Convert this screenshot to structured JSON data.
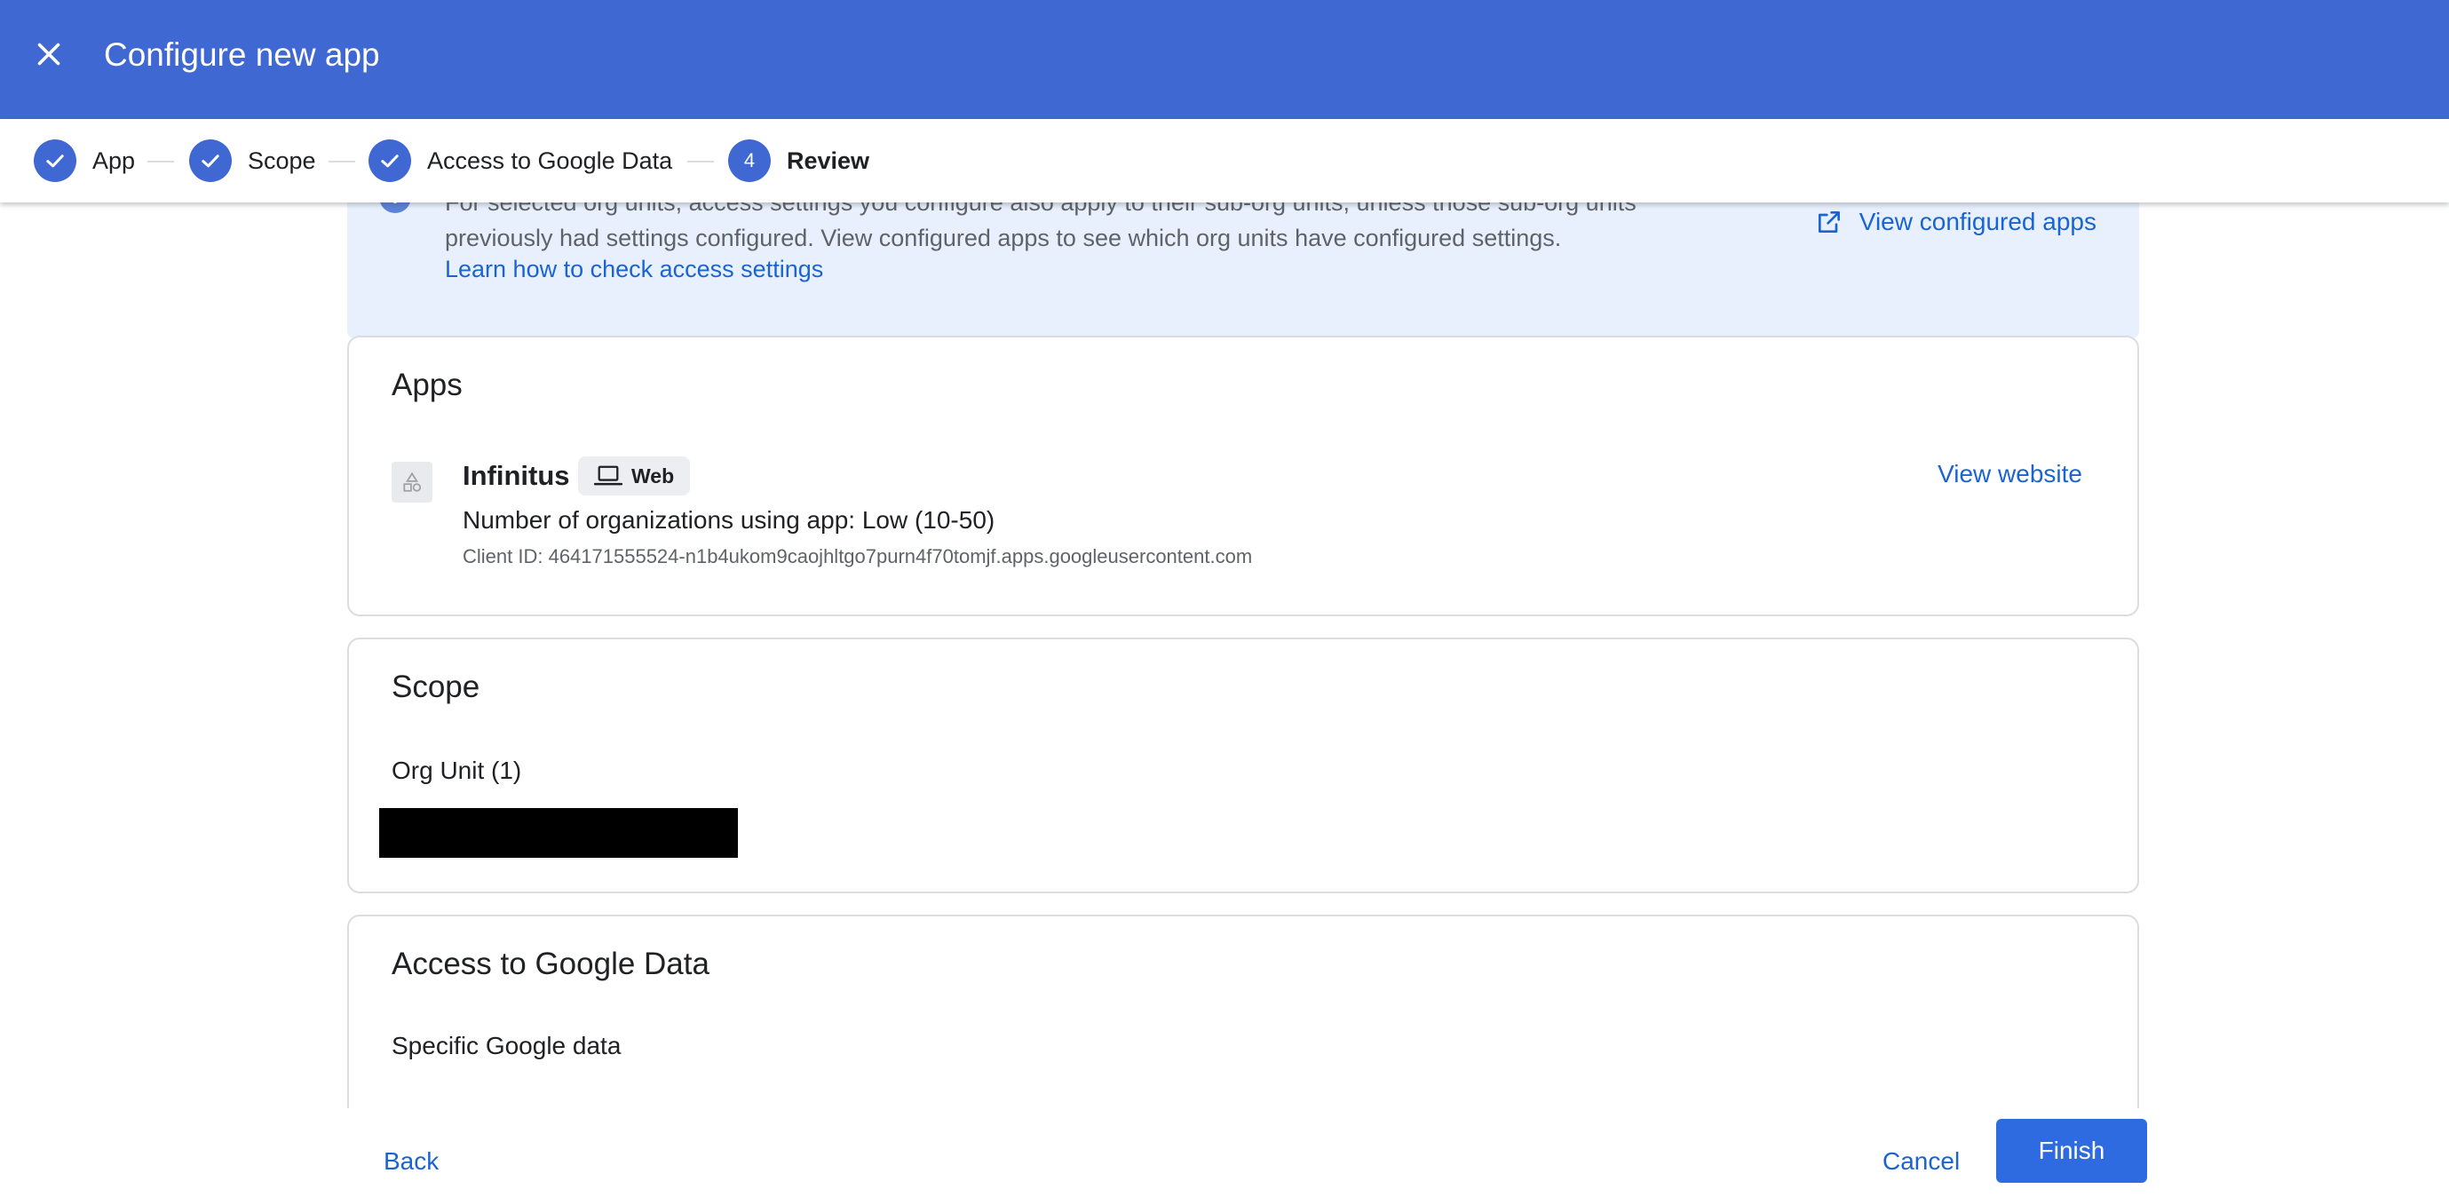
{
  "header": {
    "title": "Configure new app",
    "close_icon": "close-icon"
  },
  "stepper": {
    "steps": [
      {
        "label": "App",
        "state": "done"
      },
      {
        "label": "Scope",
        "state": "done"
      },
      {
        "label": "Access to Google Data",
        "state": "done"
      },
      {
        "label": "Review",
        "state": "current",
        "number": "4"
      }
    ]
  },
  "info_banner": {
    "line1": "For selected org units, access settings you configure also apply to their sub-org units, unless those sub-org units",
    "line2": "previously had settings configured. View configured apps to see which org units have configured settings.",
    "link": "Learn how to check access settings",
    "view_configured": "View configured apps"
  },
  "apps_card": {
    "title": "Apps",
    "app_name": "Infinitus",
    "chip": "Web",
    "orgs_line": "Number of organizations using app: Low (10-50)",
    "client_id": "Client ID: 464171555524-n1b4ukom9caojhltgo7purn4f70tomjf.apps.googleusercontent.com",
    "view_website": "View website"
  },
  "scope_card": {
    "title": "Scope",
    "org_unit_label": "Org Unit (1)"
  },
  "access_card": {
    "title": "Access to Google Data",
    "specific_label": "Specific Google data"
  },
  "footer": {
    "back": "Back",
    "cancel": "Cancel",
    "finish": "Finish"
  },
  "colors": {
    "header_bg": "#3f68d3",
    "accent": "#1a64d2",
    "primary_button": "#2f6be0",
    "banner_bg": "#e8f0fe"
  }
}
